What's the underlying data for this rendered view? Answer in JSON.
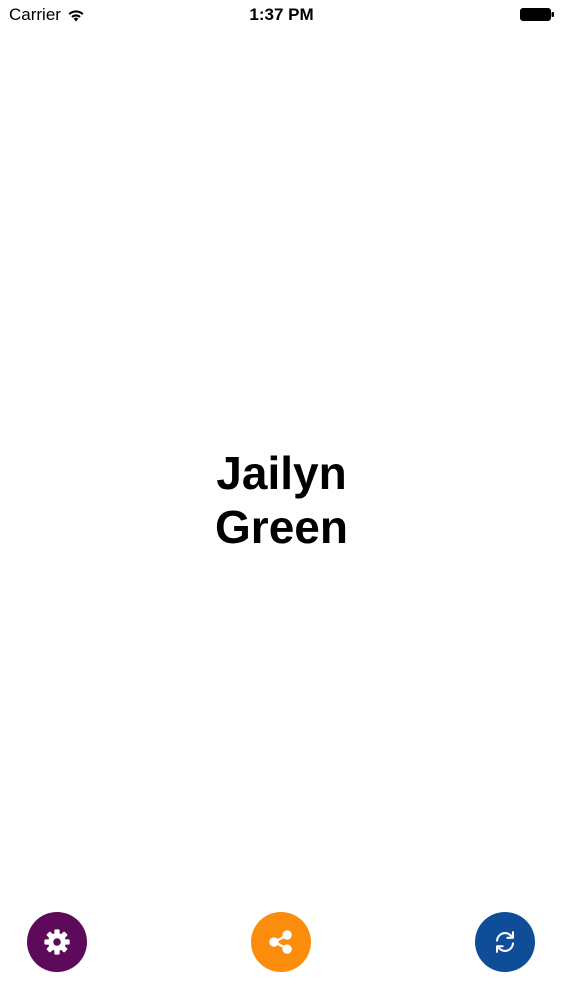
{
  "status_bar": {
    "carrier": "Carrier",
    "time": "1:37 PM"
  },
  "profile": {
    "first_name": "Jailyn",
    "last_name": "Green"
  },
  "actions": [
    {
      "name": "settings",
      "icon": "gear-icon",
      "color": "#5e0a5b"
    },
    {
      "name": "share",
      "icon": "share-icon",
      "color": "#fb8c0c"
    },
    {
      "name": "refresh",
      "icon": "refresh-icon",
      "color": "#0f4d99"
    }
  ]
}
